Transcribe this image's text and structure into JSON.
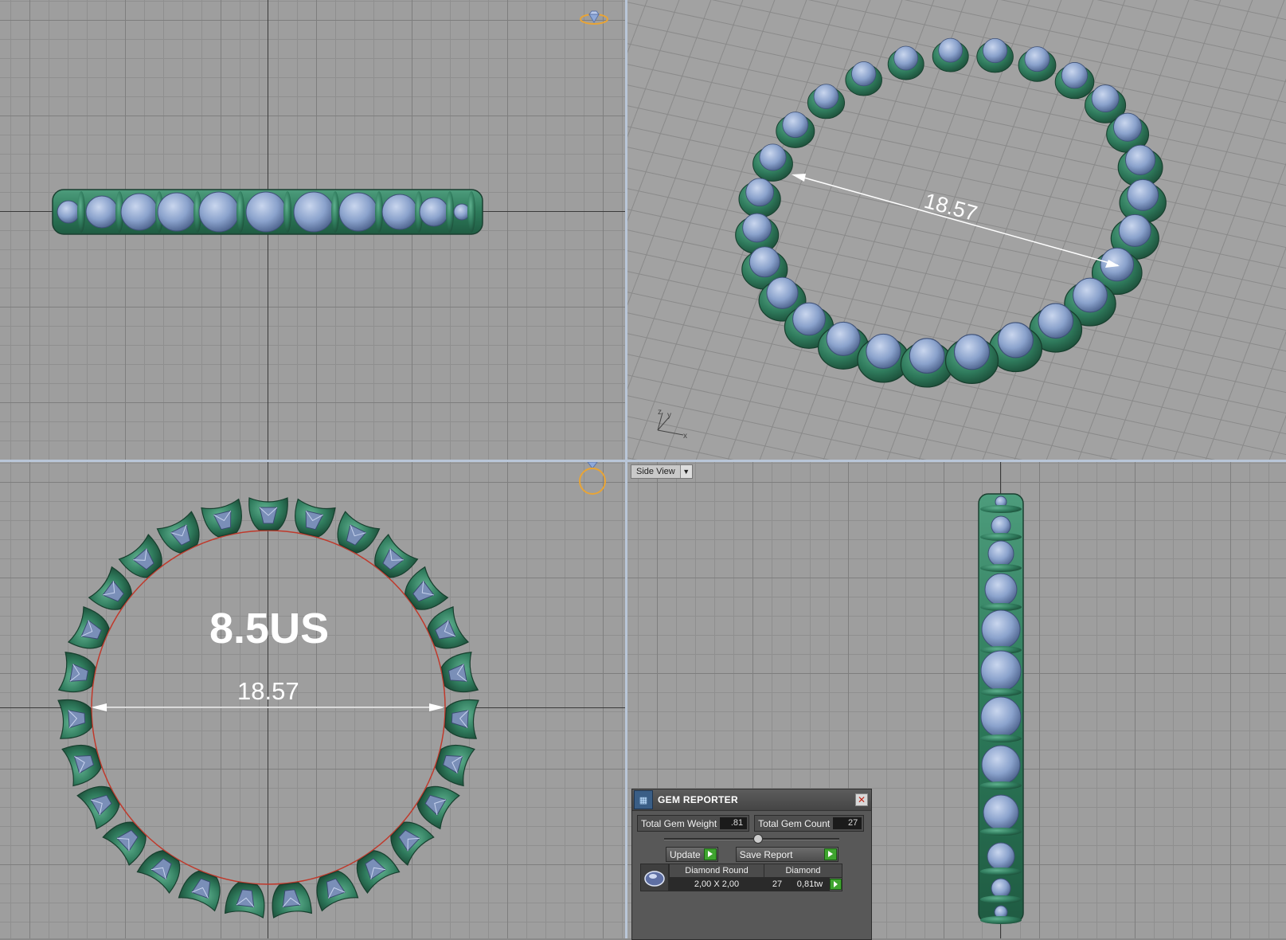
{
  "viewports": {
    "bottom_right_view_label": "Side View",
    "bottom_left_size_label": "8.5US",
    "dimension_value_perspective": "18.57",
    "dimension_value_top": "18.57",
    "axis_labels": {
      "z": "z",
      "y": "y",
      "x": "x"
    }
  },
  "gem_reporter": {
    "title": "GEM REPORTER",
    "total_gem_weight_label": "Total Gem Weight",
    "total_gem_weight_value": ".81",
    "total_gem_count_label": "Total Gem Count",
    "total_gem_count_value": "27",
    "update_label": "Update",
    "save_report_label": "Save Report",
    "gem_shape": "Diamond Round",
    "gem_material": "Diamond",
    "gem_size": "2,00 X 2,00",
    "gem_count": "27",
    "gem_weight": "0,81tw"
  },
  "colors": {
    "metal": "#2f7a5c",
    "gem": "#7f97c2",
    "grid_bg": "#9e9e9e",
    "panel_bg": "#585858"
  },
  "icons": [
    "ring-diamond-icon",
    "ring-top-icon",
    "gem-reporter-icon",
    "close-icon",
    "gem-thumbnail-icon"
  ]
}
